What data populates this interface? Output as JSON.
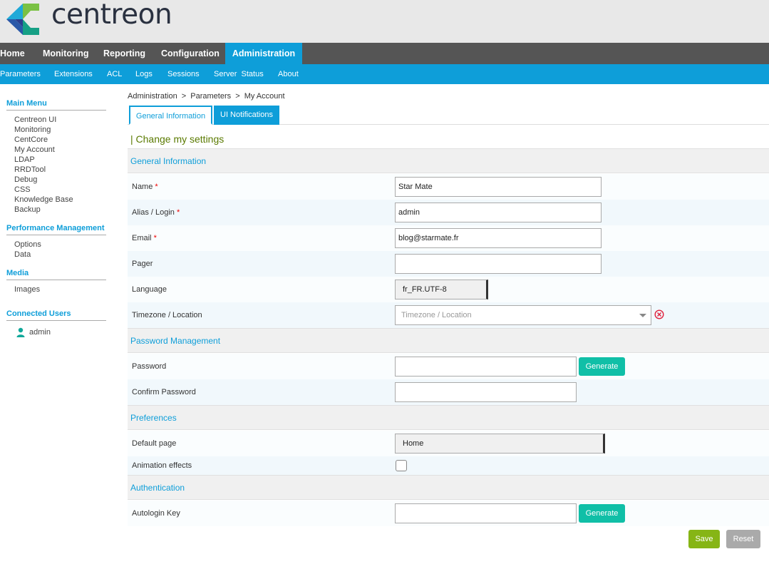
{
  "brand": {
    "name": "centreon",
    "accent": "#0e9ed9",
    "green": "#86b515",
    "teal": "#10bfa7"
  },
  "topnav": [
    "Home",
    "Monitoring",
    "Reporting",
    "Configuration",
    "Administration"
  ],
  "subnav": [
    "Parameters",
    "Extensions",
    "ACL",
    "Logs",
    "Sessions",
    "Server  Status",
    "About"
  ],
  "sidebar": {
    "main_menu": {
      "title": "Main Menu",
      "items": [
        "Centreon UI",
        "Monitoring",
        "CentCore",
        "My Account",
        "LDAP",
        "RRDTool",
        "Debug",
        "CSS",
        "Knowledge Base",
        "Backup"
      ]
    },
    "performance": {
      "title": "Performance Management",
      "items": [
        "Options",
        "Data"
      ]
    },
    "media": {
      "title": "Media",
      "items": [
        "Images"
      ]
    },
    "connected": {
      "title": "Connected Users",
      "users": [
        "admin"
      ]
    }
  },
  "breadcrumb": [
    "Administration",
    ">",
    "Parameters",
    ">",
    "My Account"
  ],
  "tabs": {
    "general": "General Information",
    "notifications": "UI Notifications"
  },
  "page_title": "| Change my settings",
  "sections": {
    "general": "General Information",
    "password": "Password Management",
    "preferences": "Preferences",
    "auth": "Authentication"
  },
  "fields": {
    "name": {
      "label": "Name",
      "required": "*",
      "value": "Star Mate"
    },
    "alias": {
      "label": "Alias / Login",
      "required": "*",
      "value": "admin"
    },
    "email": {
      "label": "Email",
      "required": "*",
      "value": "blog@starmate.fr"
    },
    "pager": {
      "label": "Pager",
      "value": ""
    },
    "language": {
      "label": "Language",
      "value": "fr_FR.UTF-8"
    },
    "timezone": {
      "label": "Timezone / Location",
      "placeholder": "Timezone / Location"
    },
    "password": {
      "label": "Password",
      "value": ""
    },
    "confirm_password": {
      "label": "Confirm Password",
      "value": ""
    },
    "default_page": {
      "label": "Default page",
      "value": "Home"
    },
    "animation": {
      "label": "Animation effects",
      "checked": false
    },
    "autologin": {
      "label": "Autologin Key",
      "value": ""
    }
  },
  "buttons": {
    "generate": "Generate",
    "save": "Save",
    "reset": "Reset"
  },
  "icons": {
    "user": "user-icon",
    "clear": "clear-circle-icon",
    "caret": "chevron-down-icon"
  }
}
